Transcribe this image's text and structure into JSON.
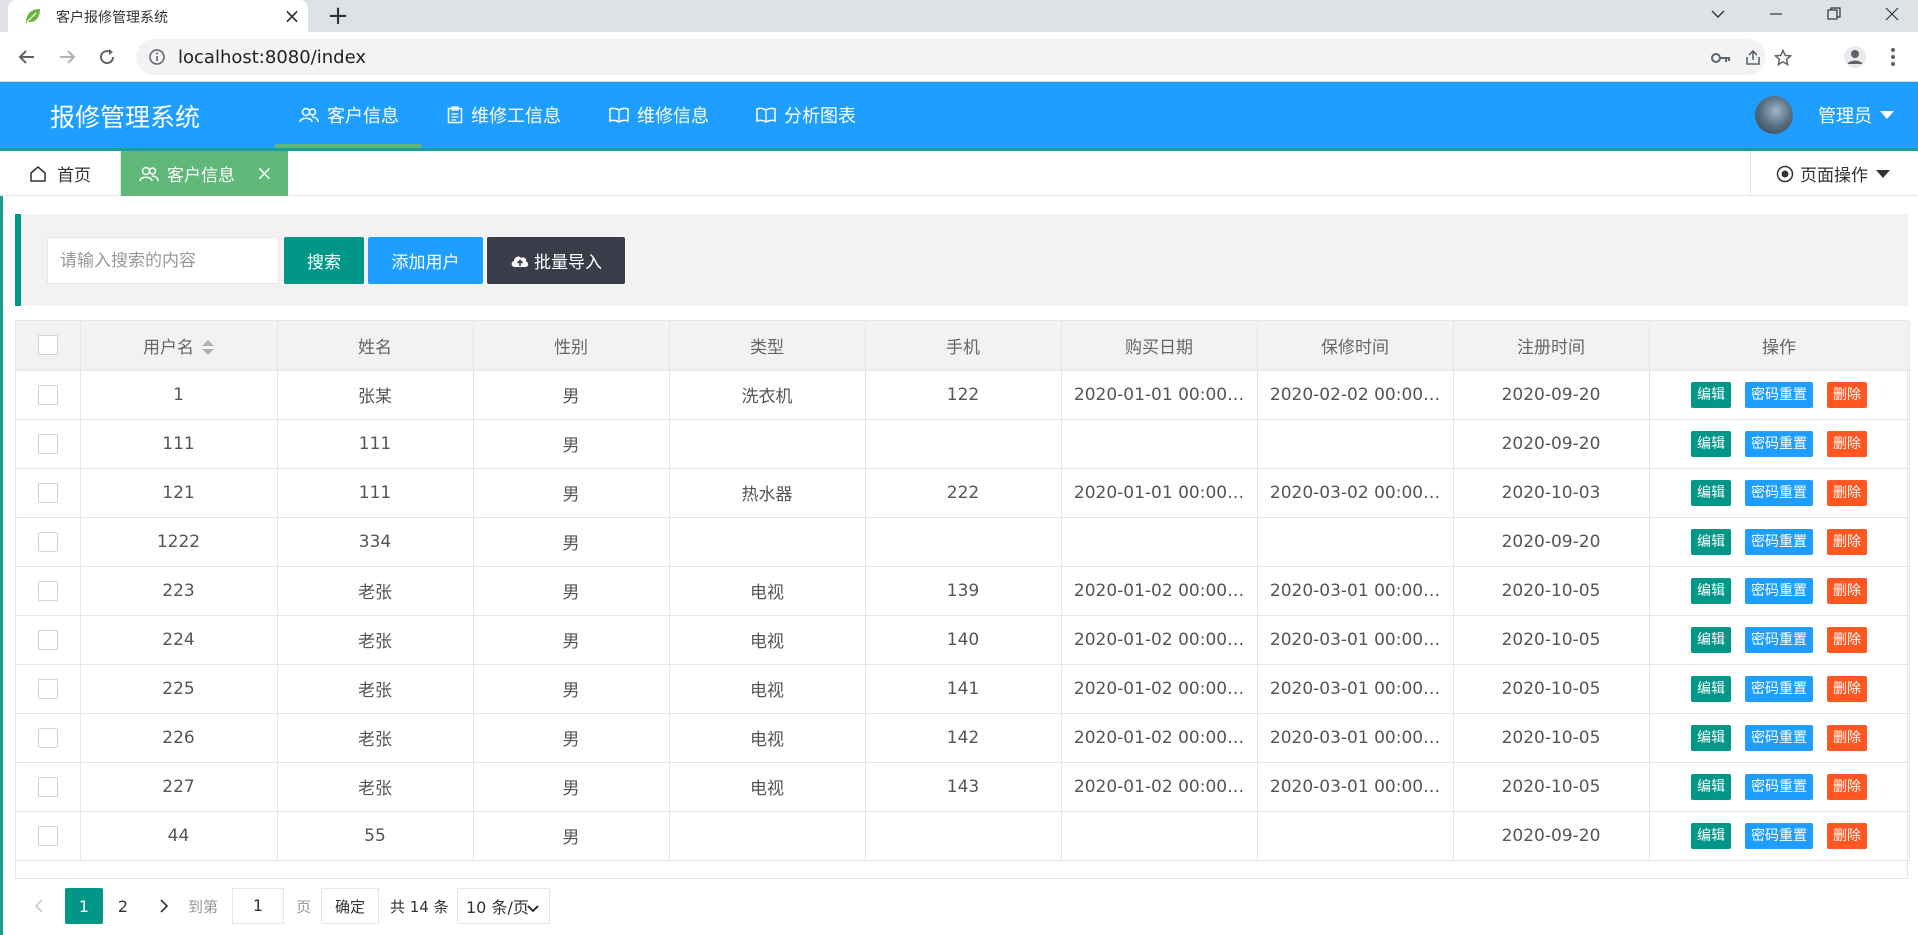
{
  "browser": {
    "tab_title": "客户报修管理系统",
    "url": "localhost:8080/index"
  },
  "app": {
    "logo": "报修管理系统",
    "nav": [
      {
        "label": "客户信息",
        "icon": "users-icon"
      },
      {
        "label": "维修工信息",
        "icon": "clipboard-icon"
      },
      {
        "label": "维修信息",
        "icon": "book-icon"
      },
      {
        "label": "分析图表",
        "icon": "book-icon"
      }
    ],
    "user_name": "管理员"
  },
  "tabbar": {
    "home": "首页",
    "active_tab": "客户信息",
    "page_ops": "页面操作"
  },
  "search": {
    "placeholder": "请输入搜索的内容",
    "search_label": "搜索",
    "add_label": "添加用户",
    "import_label": "批量导入"
  },
  "table": {
    "columns": [
      "用户名",
      "姓名",
      "性别",
      "类型",
      "手机",
      "购买日期",
      "保修时间",
      "注册时间",
      "操作"
    ],
    "actions": {
      "edit": "编辑",
      "reset": "密码重置",
      "delete": "删除"
    },
    "rows": [
      {
        "username": "1",
        "name": "张某",
        "gender": "男",
        "type": "洗衣机",
        "phone": "122",
        "purchase": "2020-01-01 00:00…",
        "warranty": "2020-02-02 00:00…",
        "registered": "2020-09-20"
      },
      {
        "username": "111",
        "name": "111",
        "gender": "男",
        "type": "",
        "phone": "",
        "purchase": "",
        "warranty": "",
        "registered": "2020-09-20"
      },
      {
        "username": "121",
        "name": "111",
        "gender": "男",
        "type": "热水器",
        "phone": "222",
        "purchase": "2020-01-01 00:00…",
        "warranty": "2020-03-02 00:00…",
        "registered": "2020-10-03"
      },
      {
        "username": "1222",
        "name": "334",
        "gender": "男",
        "type": "",
        "phone": "",
        "purchase": "",
        "warranty": "",
        "registered": "2020-09-20"
      },
      {
        "username": "223",
        "name": "老张",
        "gender": "男",
        "type": "电视",
        "phone": "139",
        "purchase": "2020-01-02 00:00…",
        "warranty": "2020-03-01 00:00…",
        "registered": "2020-10-05"
      },
      {
        "username": "224",
        "name": "老张",
        "gender": "男",
        "type": "电视",
        "phone": "140",
        "purchase": "2020-01-02 00:00…",
        "warranty": "2020-03-01 00:00…",
        "registered": "2020-10-05"
      },
      {
        "username": "225",
        "name": "老张",
        "gender": "男",
        "type": "电视",
        "phone": "141",
        "purchase": "2020-01-02 00:00…",
        "warranty": "2020-03-01 00:00…",
        "registered": "2020-10-05"
      },
      {
        "username": "226",
        "name": "老张",
        "gender": "男",
        "type": "电视",
        "phone": "142",
        "purchase": "2020-01-02 00:00…",
        "warranty": "2020-03-01 00:00…",
        "registered": "2020-10-05"
      },
      {
        "username": "227",
        "name": "老张",
        "gender": "男",
        "type": "电视",
        "phone": "143",
        "purchase": "2020-01-02 00:00…",
        "warranty": "2020-03-01 00:00…",
        "registered": "2020-10-05"
      },
      {
        "username": "44",
        "name": "55",
        "gender": "男",
        "type": "",
        "phone": "",
        "purchase": "",
        "warranty": "",
        "registered": "2020-09-20"
      }
    ]
  },
  "pagination": {
    "current": "1",
    "page2": "2",
    "goto_label": "到第",
    "goto_value": "1",
    "page_unit": "页",
    "confirm": "确定",
    "total": "共 14 条",
    "page_size": "10 条/页"
  },
  "colors": {
    "header_blue": "#1e9fff",
    "teal": "#009688",
    "green": "#5fb878",
    "dark": "#393d49",
    "danger": "#ff5722"
  }
}
